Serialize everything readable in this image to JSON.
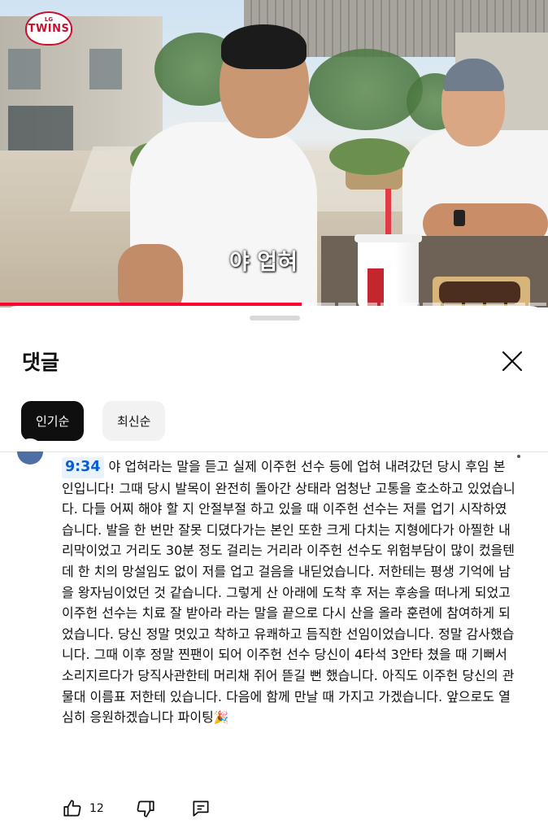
{
  "video": {
    "channel_logo_small": "LG",
    "channel_logo_text": "TWINS",
    "caption": "야 업혀",
    "progress_fraction": 0.55
  },
  "comments_panel": {
    "title": "댓글",
    "sort_chips": [
      {
        "label": "인기순",
        "active": true
      },
      {
        "label": "최신순",
        "active": false
      }
    ]
  },
  "comment": {
    "timestamp": "9:34",
    "text": "야 업혀라는 말을 듣고 실제 이주헌 선수 등에 업혀 내려갔던 당시 후임 본인입니다! 그때 당시 발목이 완전히 돌아간 상태라 엄청난 고통을 호소하고 있었습니다. 다들 어찌 해야 할 지 안절부절 하고 있을 때 이주헌 선수는 저를 업기 시작하였습니다. 발을 한 번만 잘못 디뎠다가는 본인 또한 크게 다치는 지형에다가 아찔한 내리막이었고 거리도 30분 정도 걸리는 거리라 이주헌 선수도 위험부담이 많이 컸을텐데 한 치의 망설임도 없이 저를 업고 걸음을 내딛었습니다. 저한테는 평생 기억에 남을 왕자님이었던 것 같습니다. 그렇게 산 아래에 도착 후 저는 후송을 떠나게 되었고 이주헌 선수는 치료 잘 받아라 라는 말을 끝으로 다시 산을 올라 훈련에 참여하게 되었습니다. 당신 정말 멋있고 착하고 유쾌하고 듬직한 선임이었습니다. 정말 감사했습니다. 그때 이후 정말 찐팬이 되어 이주헌 선수 당신이 4타석 3안타 쳤을 때 기뻐서 소리지르다가 당직사관한테 머리채 쥐어 뜯길 뻔 했습니다. 아직도 이주헌 당신의 관물대 이름표 저한테 있습니다. 다음에 함께 만날 때 가지고 가겠습니다. 앞으로도 열심히 응원하겠습니다 파이팅",
    "emoji": "🎉",
    "like_count": "12"
  },
  "icons": {
    "close": "close-icon",
    "like": "thumbs-up-icon",
    "dislike": "thumbs-down-icon",
    "reply": "reply-icon"
  }
}
